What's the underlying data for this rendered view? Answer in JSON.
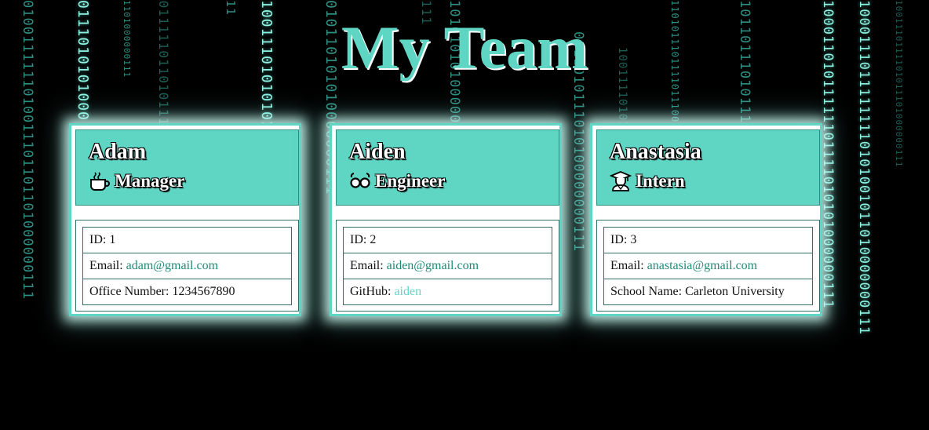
{
  "page": {
    "title": "My Team"
  },
  "colors": {
    "accent": "#5fd6c4",
    "background": "#000000",
    "link": "#1f8a78"
  },
  "employees": [
    {
      "name": "Adam",
      "role": "Manager",
      "role_icon": "coffee-mug-icon",
      "id_label": "ID: 1",
      "email_prefix": "Email: ",
      "email": "adam@gmail.com",
      "extra_prefix": "Office Number: ",
      "extra_value": "1234567890"
    },
    {
      "name": "Aiden",
      "role": "Engineer",
      "role_icon": "glasses-icon",
      "id_label": "ID: 2",
      "email_prefix": "Email: ",
      "email": "aiden@gmail.com",
      "extra_prefix": "GitHub: ",
      "extra_value": "aiden"
    },
    {
      "name": "Anastasia",
      "role": "Intern",
      "role_icon": "graduate-icon",
      "id_label": "ID: 3",
      "email_prefix": "Email: ",
      "email": "anastasia@gmail.com",
      "extra_prefix": "School Name: ",
      "extra_value": "Carleton University"
    }
  ],
  "background_rain": [
    "0100111111010011101101101000000111",
    "0111010101000",
    "1101000000111",
    "0011111011010111011",
    "11",
    "10011101010101000000111",
    "010110101010000000111",
    "111",
    "101010101000000111",
    "0011010111010100000000111",
    "100111101011101110111",
    "1101011101111011100000000111",
    "1011011101011101000000111",
    "10001101011111101111010101000000111",
    "10001110111111110101001011010000000111",
    "1001110111101011101000000111"
  ]
}
